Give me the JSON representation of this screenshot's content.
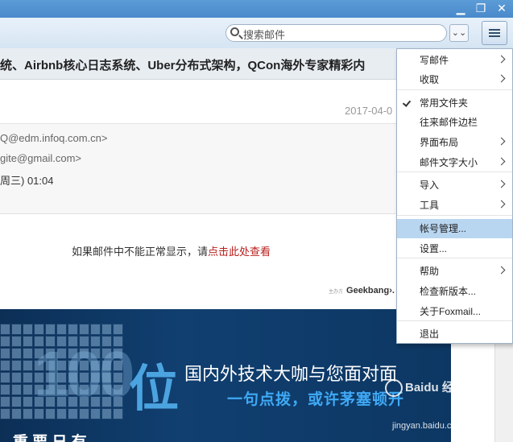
{
  "window": {
    "minimize_label": "▁",
    "restore_label": "❐",
    "close_label": "✕"
  },
  "toolbar": {
    "search_placeholder": "搜索邮件",
    "dropdown_label": "⌄⌄"
  },
  "email": {
    "subject": "统、Airbnb核心日志系统、Uber分布式架构，QCon海外专家精彩内",
    "date": "2017-04-0",
    "from": "Q@edm.infoq.com.cn>",
    "to": "gite@gmail.com>",
    "time": "周三) 01:04",
    "notice_text": "如果邮件中不能正常显示，请",
    "notice_link": "点击此处查看",
    "sponsor_small": "主办方",
    "sponsor_logo": "Geekbang›.",
    "banner_line1": "国内外技术大咖与您面对面",
    "banner_line2": "一句点拨，或许茅塞顿开",
    "banner_big": "100",
    "banner_char": "位",
    "banner_bottom": "...重 要 日 有 ..."
  },
  "menu": {
    "items": [
      {
        "label": "写邮件",
        "submenu": true,
        "checked": false
      },
      {
        "label": "收取",
        "submenu": true,
        "checked": false
      },
      {
        "label": "常用文件夹",
        "submenu": false,
        "checked": true
      },
      {
        "label": "往来邮件边栏",
        "submenu": false,
        "checked": false
      },
      {
        "label": "界面布局",
        "submenu": true,
        "checked": false
      },
      {
        "label": "邮件文字大小",
        "submenu": true,
        "checked": false
      },
      {
        "label": "导入",
        "submenu": true,
        "checked": false
      },
      {
        "label": "工具",
        "submenu": true,
        "checked": false
      },
      {
        "label": "帐号管理...",
        "submenu": false,
        "checked": false,
        "highlighted": true
      },
      {
        "label": "设置...",
        "submenu": false,
        "checked": false
      },
      {
        "label": "帮助",
        "submenu": true,
        "checked": false
      },
      {
        "label": "检查新版本...",
        "submenu": false,
        "checked": false
      },
      {
        "label": "关于Foxmail...",
        "submenu": false,
        "checked": false
      },
      {
        "label": "退出",
        "submenu": false,
        "checked": false
      }
    ]
  },
  "watermark": {
    "brand": "Baidu 经验",
    "url": "jingyan.baidu.com"
  }
}
